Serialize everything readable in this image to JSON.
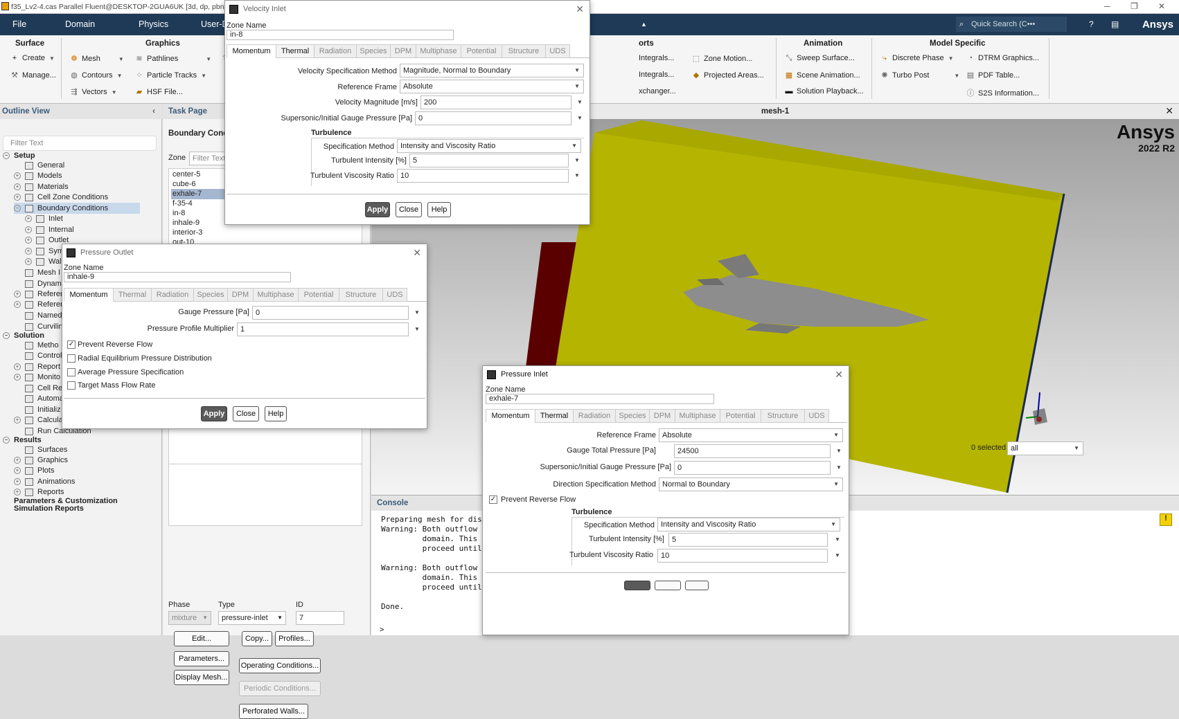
{
  "window": {
    "title": "f35_Lv2-4.cas Parallel Fluent@DESKTOP-2GUA6UK  [3d, dp, pbns, ske, 8"
  },
  "menu": {
    "items": [
      "File",
      "Domain",
      "Physics",
      "User-Defi"
    ],
    "search_placeholder": "Quick Search (C•••",
    "brand": "Ansys"
  },
  "ribbon": {
    "surface": {
      "title": "Surface",
      "create": "Create",
      "manage": "Manage..."
    },
    "graphics": {
      "title": "Graphics",
      "mesh": "Mesh",
      "contours": "Contours",
      "vectors": "Vectors",
      "pathlines": "Pathlines",
      "particle_tracks": "Particle Tracks",
      "hsf": "HSF File...",
      "lic": "LI"
    },
    "reports": {
      "title": "orts",
      "a": "Integrals...",
      "b": "Integrals...",
      "c": "xchanger...",
      "zone_motion": "Zone Motion...",
      "projected_areas": "Projected Areas..."
    },
    "animation": {
      "title": "Animation",
      "sweep": "Sweep Surface...",
      "scene": "Scene Animation...",
      "playback": "Solution Playback..."
    },
    "model_specific": {
      "title": "Model Specific",
      "discrete_phase": "Discrete Phase",
      "turbo_post": "Turbo Post",
      "dtrm": "DTRM Graphics...",
      "pdf": "PDF Table...",
      "s2s": "S2S Information..."
    }
  },
  "outline": {
    "title": "Outline View",
    "filter_placeholder": "Filter Text",
    "items": [
      {
        "label": "Setup",
        "bold": true
      },
      {
        "label": "General"
      },
      {
        "label": "Models"
      },
      {
        "label": "Materials"
      },
      {
        "label": "Cell Zone Conditions"
      },
      {
        "label": "Boundary Conditions",
        "selected": true
      },
      {
        "label": "Inlet"
      },
      {
        "label": "Internal"
      },
      {
        "label": "Outlet"
      },
      {
        "label": "Sym"
      },
      {
        "label": "Wal"
      },
      {
        "label": "Mesh I"
      },
      {
        "label": "Dynami"
      },
      {
        "label": "Referer"
      },
      {
        "label": "Referer"
      },
      {
        "label": "Named"
      },
      {
        "label": "Curvilin"
      },
      {
        "label": "Solution",
        "bold": true
      },
      {
        "label": "Metho"
      },
      {
        "label": "Control"
      },
      {
        "label": "Report"
      },
      {
        "label": "Monito"
      },
      {
        "label": "Cell Re"
      },
      {
        "label": "Automa"
      },
      {
        "label": "Initializ"
      },
      {
        "label": "Calculat"
      },
      {
        "label": "Run Calculation"
      },
      {
        "label": "Results",
        "bold": true
      },
      {
        "label": "Surfaces"
      },
      {
        "label": "Graphics"
      },
      {
        "label": "Plots"
      },
      {
        "label": "Animations"
      },
      {
        "label": "Reports"
      },
      {
        "label": "Parameters & Customization",
        "bold": true
      },
      {
        "label": "Simulation Reports",
        "bold": true
      }
    ]
  },
  "task": {
    "title": "Task Page",
    "section": "Boundary Conditio",
    "zone_label": "Zone",
    "zone_filter": "Filter Text",
    "zones": [
      "center-5",
      "cube-6",
      "exhale-7",
      "f-35-4",
      "in-8",
      "inhale-9",
      "interior-3",
      "out-10"
    ],
    "phase_label": "Phase",
    "phase_value": "mixture",
    "type_label": "Type",
    "type_value": "pressure-inlet",
    "id_label": "ID",
    "id_value": "7",
    "buttons": {
      "edit": "Edit...",
      "copy": "Copy...",
      "profiles": "Profiles...",
      "parameters": "Parameters...",
      "operating": "Operating Conditions...",
      "display_mesh": "Display Mesh...",
      "periodic": "Periodic Conditions...",
      "perforated": "Perforated Walls..."
    }
  },
  "viewport": {
    "title": "mesh-1",
    "logo": "Ansys",
    "version": "2022 R2",
    "selected_label": "0 selected",
    "filter_value": "all"
  },
  "console": {
    "title": "Console",
    "lines": "Preparing mesh for display...\nWarning: Both outflow and pre\n         domain. This is an i\n         proceed until this i\n\nWarning: Both outflow and pre\n         domain. This is an i\n         proceed until this i\n\nDone.",
    "prompt": ">"
  },
  "tabs": [
    "Momentum",
    "Thermal",
    "Radiation",
    "Species",
    "DPM",
    "Multiphase",
    "Potential",
    "Structure",
    "UDS"
  ],
  "velocity_inlet": {
    "title": "Velocity Inlet",
    "zone_name_label": "Zone Name",
    "zone_name": "in-8",
    "vsm_label": "Velocity Specification Method",
    "vsm": "Magnitude, Normal to Boundary",
    "rf_label": "Reference Frame",
    "rf": "Absolute",
    "vm_label": "Velocity Magnitude [m/s]",
    "vm": "200",
    "sigp_label": "Supersonic/Initial Gauge Pressure [Pa]",
    "sigp": "0",
    "turb": "Turbulence",
    "sm_label": "Specification Method",
    "sm": "Intensity and Viscosity Ratio",
    "ti_label": "Turbulent Intensity [%]",
    "ti": "5",
    "tvr_label": "Turbulent Viscosity Ratio",
    "tvr": "10",
    "apply": "Apply",
    "close": "Close",
    "help": "Help"
  },
  "pressure_outlet": {
    "title": "Pressure Outlet",
    "zone_name_label": "Zone Name",
    "zone_name": "inhale-9",
    "gp_label": "Gauge Pressure [Pa]",
    "gp": "0",
    "ppm_label": "Pressure Profile Multiplier",
    "ppm": "1",
    "prf": "Prevent Reverse Flow",
    "red": "Radial Equilibrium Pressure Distribution",
    "aps": "Average Pressure Specification",
    "tmfr": "Target Mass Flow Rate",
    "apply": "Apply",
    "close": "Close",
    "help": "Help"
  },
  "pressure_inlet": {
    "title": "Pressure Inlet",
    "zone_name_label": "Zone Name",
    "zone_name": "exhale-7",
    "rf_label": "Reference Frame",
    "rf": "Absolute",
    "gtp_label": "Gauge Total Pressure [Pa]",
    "gtp": "24500",
    "sigp_label": "Supersonic/Initial Gauge Pressure [Pa]",
    "sigp": "0",
    "dsm_label": "Direction Specification Method",
    "dsm": "Normal to Boundary",
    "prf": "Prevent Reverse Flow",
    "turb": "Turbulence",
    "sm_label": "Specification Method",
    "sm": "Intensity and Viscosity Ratio",
    "ti_label": "Turbulent Intensity [%]",
    "ti": "5",
    "tvr_label": "Turbulent Viscosity Ratio",
    "tvr": "10"
  }
}
